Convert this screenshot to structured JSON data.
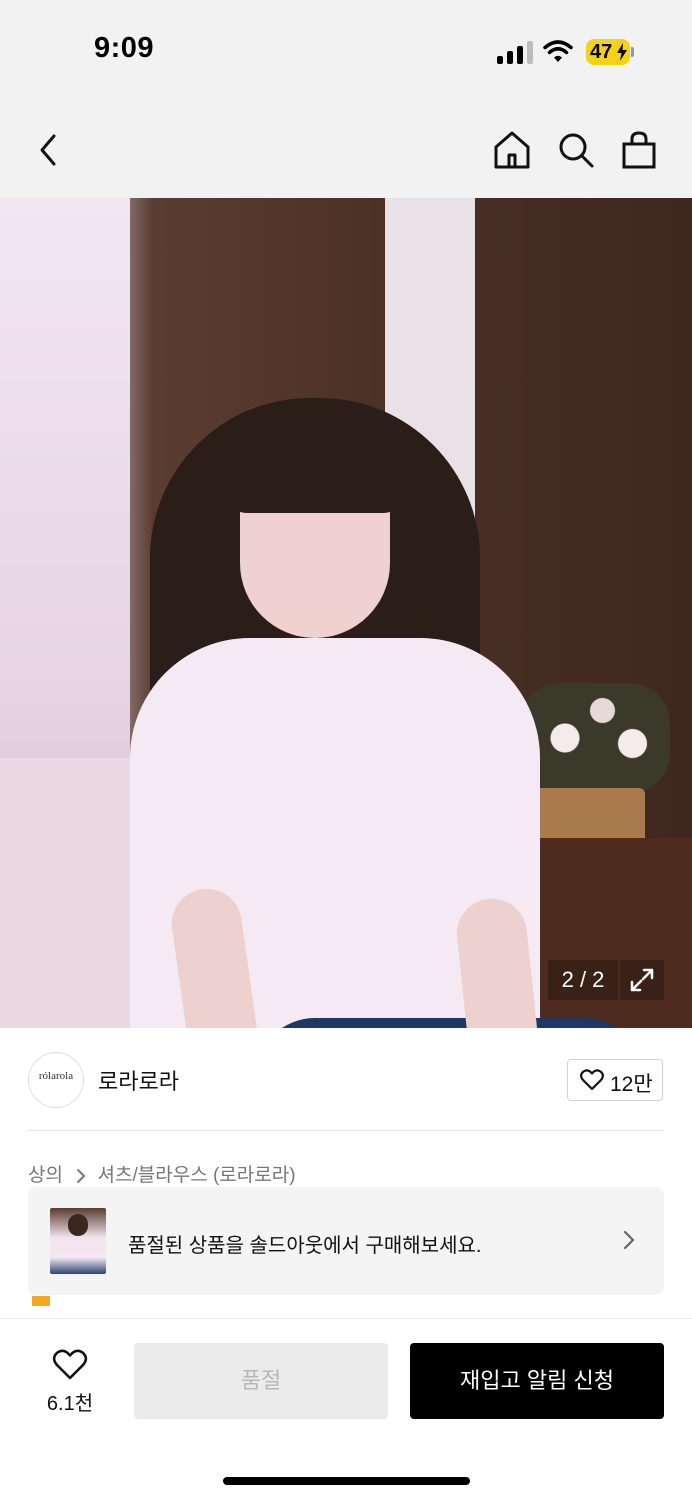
{
  "status_bar": {
    "time": "9:09",
    "battery": "47",
    "icons": [
      "signal-icon",
      "wifi-icon",
      "battery-charging-icon"
    ]
  },
  "nav": {
    "icons": [
      "back-chevron-icon",
      "home-icon",
      "search-icon",
      "shopping-bag-icon"
    ]
  },
  "gallery": {
    "counter": "2 / 2",
    "current": 2,
    "total": 2,
    "expand_icon": "expand-arrows-icon"
  },
  "brand": {
    "logo_text": "rólarola",
    "name": "로라로라",
    "likes": "12만",
    "like_icon": "heart-outline-icon"
  },
  "breadcrumb": {
    "category": "상의",
    "subcategory": "셔츠/블라우스 (로라로라)",
    "separator_icon": "chevron-right-icon"
  },
  "soldout_banner": {
    "text": "품절된 상품을 솔드아웃에서 구매해보세요.",
    "chevron_icon": "chevron-right-icon"
  },
  "bottom_bar": {
    "wish_count": "6.1천",
    "soldout_label": "품절",
    "restock_label": "재입고 알림 신청"
  },
  "colors": {
    "accent_black": "#000000",
    "disabled_gray": "#ebebeb",
    "battery_yellow": "#f4d216",
    "rating_star": "#f5a623"
  }
}
